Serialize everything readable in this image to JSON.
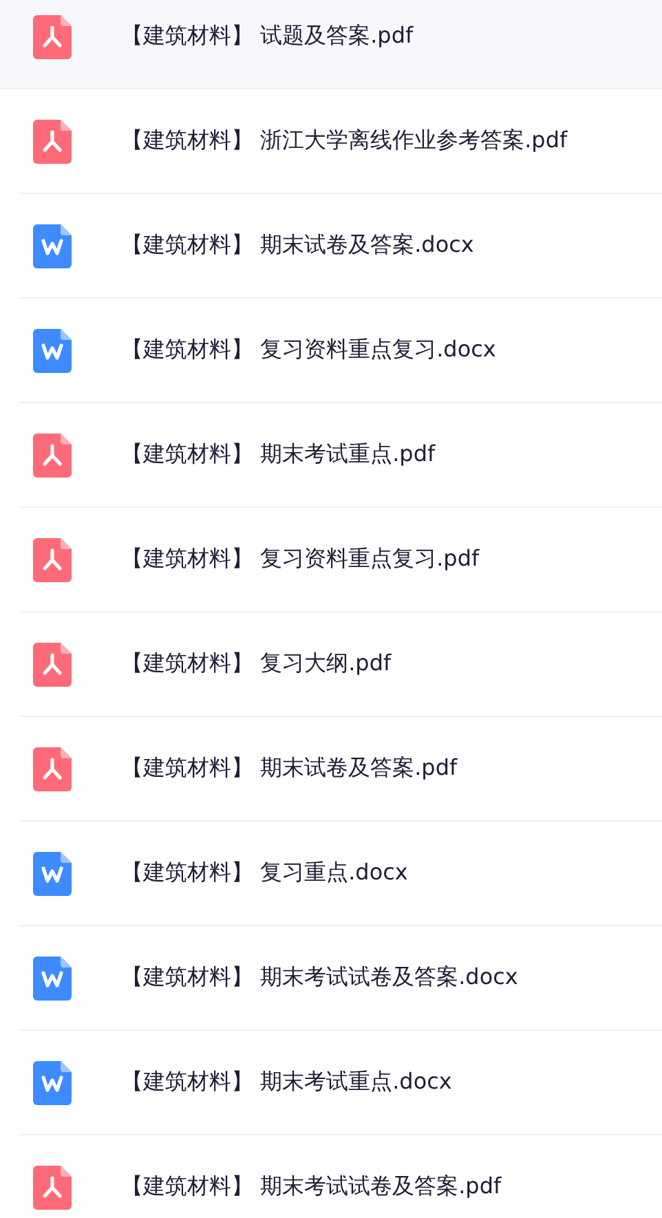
{
  "files": [
    {
      "kind": "pdf",
      "name": "【建筑材料】 试题及答案.pdf",
      "selected": true
    },
    {
      "kind": "pdf",
      "name": "【建筑材料】 浙江大学离线作业参考答案.pdf",
      "selected": false
    },
    {
      "kind": "word",
      "name": "【建筑材料】 期末试卷及答案.docx",
      "selected": false
    },
    {
      "kind": "word",
      "name": "【建筑材料】 复习资料重点复习.docx",
      "selected": false
    },
    {
      "kind": "pdf",
      "name": "【建筑材料】 期末考试重点.pdf",
      "selected": false
    },
    {
      "kind": "pdf",
      "name": "【建筑材料】 复习资料重点复习.pdf",
      "selected": false
    },
    {
      "kind": "pdf",
      "name": "【建筑材料】 复习大纲.pdf",
      "selected": false
    },
    {
      "kind": "pdf",
      "name": "【建筑材料】 期末试卷及答案.pdf",
      "selected": false
    },
    {
      "kind": "word",
      "name": "【建筑材料】 复习重点.docx",
      "selected": false
    },
    {
      "kind": "word",
      "name": "【建筑材料】 期末考试试卷及答案.docx",
      "selected": false
    },
    {
      "kind": "word",
      "name": "【建筑材料】 期末考试重点.docx",
      "selected": false
    },
    {
      "kind": "pdf",
      "name": "【建筑材料】 期末考试试卷及答案.pdf",
      "selected": false
    }
  ]
}
